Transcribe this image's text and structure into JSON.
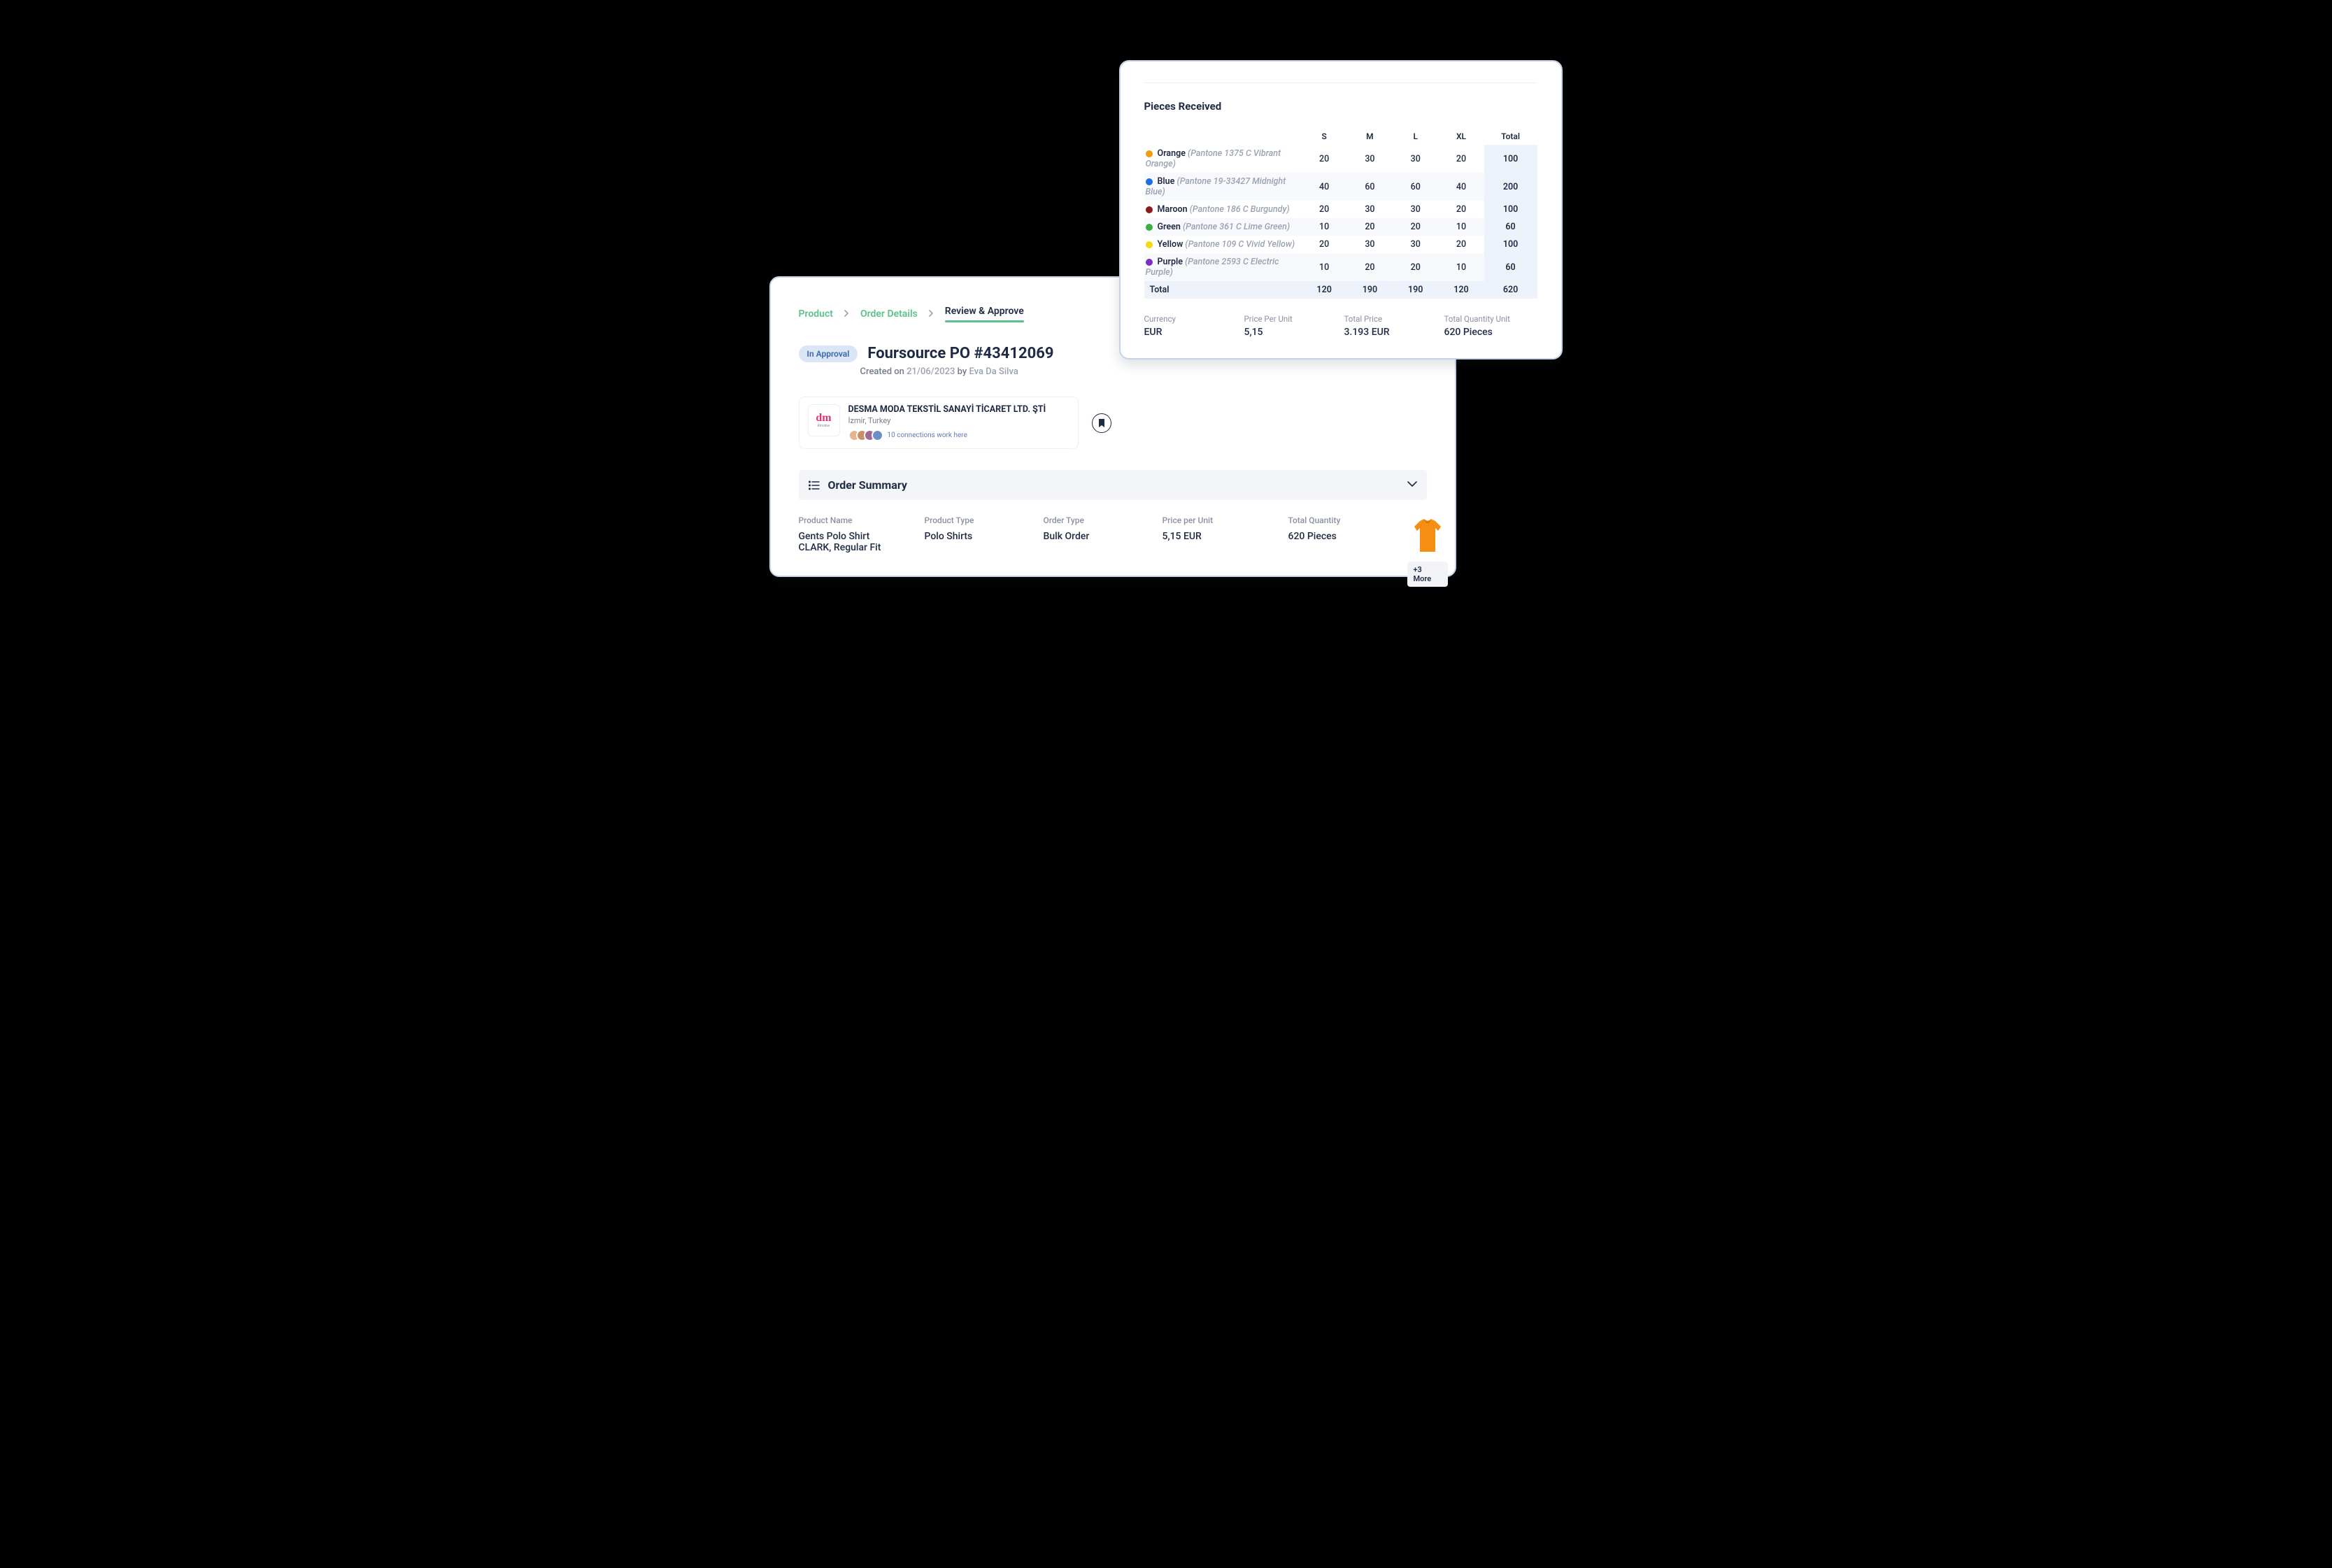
{
  "breadcrumb": {
    "product": "Product",
    "order_details": "Order Details",
    "review_approve": "Review & Approve"
  },
  "order": {
    "status": "In Approval",
    "title": "Foursource PO #43412069",
    "created_prefix": "Created on ",
    "created_date": "21/06/2023",
    "created_by_prefix": " by ",
    "created_by": "Eva Da Silva"
  },
  "supplier": {
    "logo_main": "dm",
    "logo_sub": "desma",
    "name": "DESMA MODA TEKSTİL SANAYİ TİCARET LTD. ŞTİ",
    "location": "İzmir, Turkey",
    "connections_text": "10 connections work here"
  },
  "section": {
    "title": "Order Summary"
  },
  "summary": {
    "product_name_label": "Product Name",
    "product_name": "Gents Polo Shirt CLARK, Regular Fit",
    "product_type_label": "Product Type",
    "product_type": "Polo Shirts",
    "order_type_label": "Order Type",
    "order_type": "Bulk Order",
    "ppu_label": "Price per Unit",
    "ppu": "5,15 EUR",
    "qty_label": "Total Quantity",
    "qty": "620 Pieces",
    "more_badge": "+3 More"
  },
  "pieces": {
    "title": "Pieces Received",
    "headers": {
      "s": "S",
      "m": "M",
      "l": "L",
      "xl": "XL",
      "total": "Total"
    },
    "rows": [
      {
        "dot": "#f39c12",
        "name": "Orange",
        "sub": "(Pantone 1375 C Vibrant Orange)",
        "s": "20",
        "m": "30",
        "l": "30",
        "xl": "20",
        "total": "100"
      },
      {
        "dot": "#1d6fe0",
        "name": "Blue",
        "sub": "(Pantone 19-33427 Midnight Blue)",
        "s": "40",
        "m": "60",
        "l": "60",
        "xl": "40",
        "total": "200"
      },
      {
        "dot": "#8b1a1a",
        "name": "Maroon",
        "sub": "(Pantone 186 C Burgundy)",
        "s": "20",
        "m": "30",
        "l": "30",
        "xl": "20",
        "total": "100"
      },
      {
        "dot": "#3cb043",
        "name": "Green",
        "sub": "(Pantone 361 C Lime Green)",
        "s": "10",
        "m": "20",
        "l": "20",
        "xl": "10",
        "total": "60"
      },
      {
        "dot": "#f4d90f",
        "name": "Yellow",
        "sub": "(Pantone 109 C Vivid Yellow)",
        "s": "20",
        "m": "30",
        "l": "30",
        "xl": "20",
        "total": "100"
      },
      {
        "dot": "#7b2fbf",
        "name": "Purple",
        "sub": "(Pantone 2593 C Electric Purple)",
        "s": "10",
        "m": "20",
        "l": "20",
        "xl": "10",
        "total": "60"
      }
    ],
    "totals": {
      "label": "Total",
      "s": "120",
      "m": "190",
      "l": "190",
      "xl": "120",
      "total": "620"
    },
    "strip": {
      "currency_label": "Currency",
      "currency": "EUR",
      "ppu_label": "Price Per Unit",
      "ppu": "5,15",
      "total_price_label": "Total Price",
      "total_price": "3.193 EUR",
      "tqu_label": "Total Quantity Unit",
      "tqu": "620 Pieces"
    }
  }
}
